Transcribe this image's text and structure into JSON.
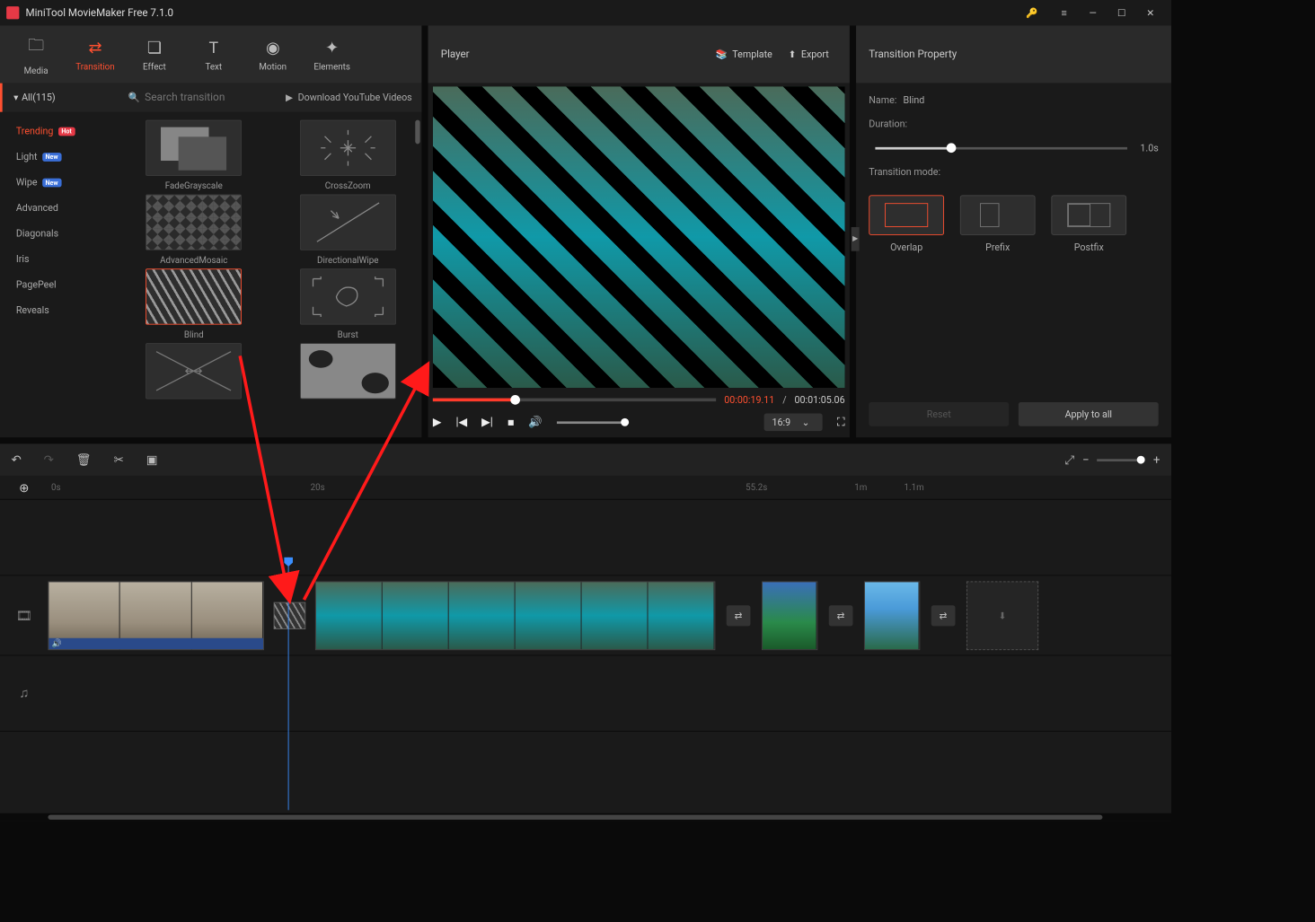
{
  "app": {
    "title": "MiniTool MovieMaker Free 7.1.0"
  },
  "nav": {
    "media": "Media",
    "transition": "Transition",
    "effect": "Effect",
    "text": "Text",
    "motion": "Motion",
    "elements": "Elements"
  },
  "player": {
    "title": "Player",
    "template": "Template",
    "export": "Export",
    "current_time": "00:00:19.11",
    "total_time": "00:01:05.06",
    "ratio": "16:9",
    "time_sep": "/"
  },
  "property": {
    "header": "Transition Property",
    "name_label": "Name:",
    "name_value": "Blind",
    "duration_label": "Duration:",
    "duration_value": "1.0s",
    "mode_label": "Transition mode:",
    "modes": {
      "overlap": "Overlap",
      "prefix": "Prefix",
      "postfix": "Postfix"
    },
    "reset": "Reset",
    "apply_all": "Apply to all"
  },
  "trans": {
    "all_label": "All(115)",
    "search_placeholder": "Search transition",
    "download_label": "Download YouTube Videos",
    "categories": [
      {
        "label": "Trending",
        "badge": "Hot",
        "badge_class": "hot",
        "active": true
      },
      {
        "label": "Light",
        "badge": "New",
        "badge_class": "new"
      },
      {
        "label": "Wipe",
        "badge": "New",
        "badge_class": "new"
      },
      {
        "label": "Advanced"
      },
      {
        "label": "Diagonals"
      },
      {
        "label": "Iris"
      },
      {
        "label": "PagePeel"
      },
      {
        "label": "Reveals"
      }
    ],
    "items": {
      "fadegray": "FadeGrayscale",
      "crosszoom": "CrossZoom",
      "mosaic": "AdvancedMosaic",
      "directional": "DirectionalWipe",
      "blind": "Blind",
      "burst": "Burst"
    }
  },
  "timeline": {
    "ticks": [
      {
        "label": "0s",
        "pos": 64
      },
      {
        "label": "20s",
        "pos": 388
      },
      {
        "label": "55.2s",
        "pos": 932
      },
      {
        "label": "1m",
        "pos": 1068
      },
      {
        "label": "1.1m",
        "pos": 1130
      }
    ]
  }
}
